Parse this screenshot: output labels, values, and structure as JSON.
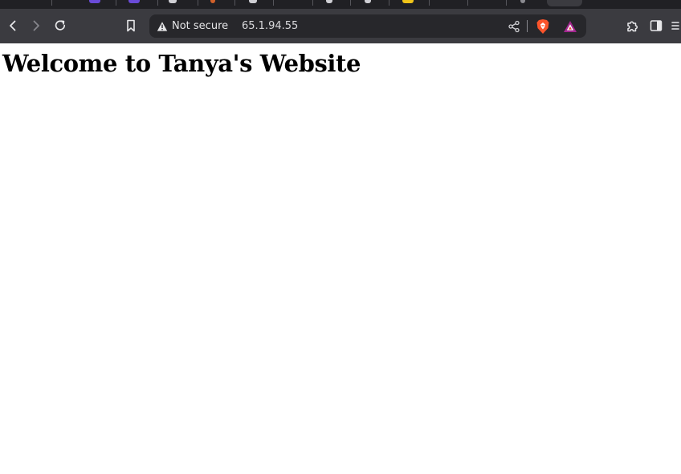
{
  "browser": {
    "security_label": "Not secure",
    "url": "65.1.94.55"
  },
  "icons": {
    "back": "chevron-left-icon",
    "forward": "chevron-right-icon",
    "reload": "reload-icon",
    "bookmark": "bookmark-icon",
    "warning": "warning-triangle-icon",
    "share": "share-icon",
    "brave_shields": "brave-lion-icon",
    "brave_rewards": "brave-rewards-triangle-icon",
    "extensions": "puzzle-icon",
    "sidebar": "sidebar-toggle-icon"
  },
  "colors": {
    "toolbar_bg": "#3b3b40",
    "tabstrip_bg": "#202024",
    "address_bg": "#27272b",
    "brave_orange": "#fb542b",
    "rewards_purple": "#a3278f",
    "page_bg": "#ffffff"
  },
  "page": {
    "heading": "Welcome to Tanya's Website"
  }
}
